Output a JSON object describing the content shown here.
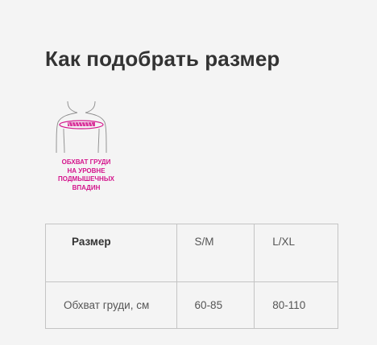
{
  "title": "Как подобрать размер",
  "figure": {
    "icon": "chest-measure-icon",
    "caption_lines": [
      "ОБХВАТ ГРУДИ",
      "НА УРОВНЕ",
      "ПОДМЫШЕЧНЫХ",
      "ВПАДИН"
    ],
    "accent_color": "#d4148c"
  },
  "table": {
    "header_label": "Размер",
    "sizes": [
      "S/M",
      "L/XL"
    ],
    "row_label": "Обхват груди, см",
    "row_values": [
      "60-85",
      "80-110"
    ]
  }
}
